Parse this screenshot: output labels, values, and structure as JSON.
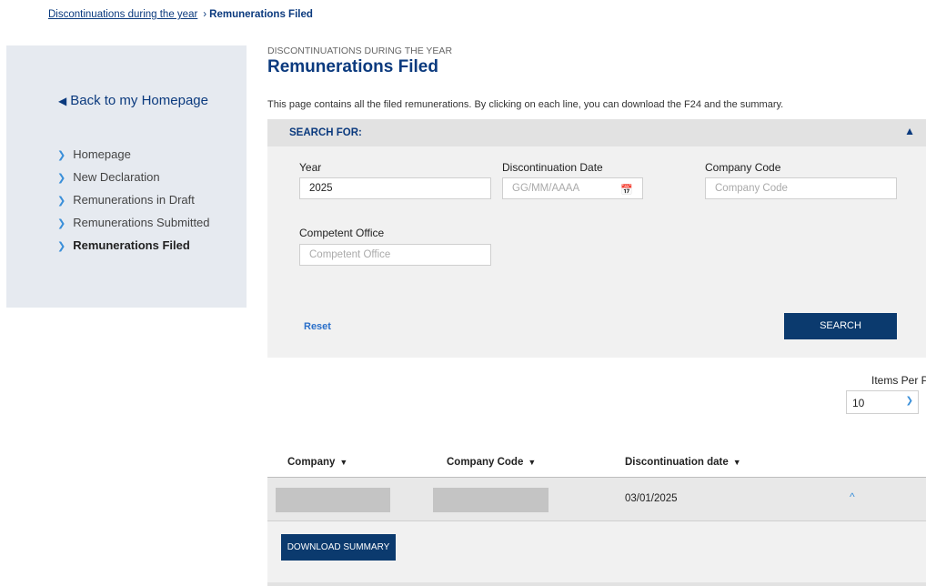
{
  "breadcrumb": {
    "parent": "Discontinuations during the year",
    "separator": "›",
    "current": "Remunerations Filed"
  },
  "sidebar": {
    "back_label": "Back to my Homepage",
    "back_icon": "◀",
    "items": [
      {
        "label": "Homepage",
        "active": false
      },
      {
        "label": "New Declaration",
        "active": false
      },
      {
        "label": "Remunerations in Draft",
        "active": false
      },
      {
        "label": "Remunerations Submitted",
        "active": false
      },
      {
        "label": "Remunerations Filed",
        "active": true
      }
    ]
  },
  "page": {
    "kicker": "DISCONTINUATIONS DURING THE YEAR",
    "title": "Remunerations Filed",
    "intro": "This page contains all the filed remunerations. By clicking on each line, you can download the F24 and the summary."
  },
  "search": {
    "header": "SEARCH FOR:",
    "year": {
      "label": "Year",
      "value": "2025"
    },
    "discontinuation_date": {
      "label": "Discontinuation Date",
      "placeholder": "GG/MM/AAAA"
    },
    "company_code": {
      "label": "Company Code",
      "placeholder": "Company Code"
    },
    "competent_office": {
      "label": "Competent Office",
      "placeholder": "Competent Office"
    },
    "reset_label": "Reset",
    "search_label": "SEARCH"
  },
  "pagination": {
    "items_per_page_label": "Items Per Page",
    "items_per_page_value": "10"
  },
  "table": {
    "columns": [
      "Company",
      "Company Code",
      "Discontinuation date"
    ],
    "sort_icon": "▼",
    "rows": [
      {
        "company": "",
        "company_code": "",
        "discontinuation_date": "03/01/2025",
        "expanded": true
      }
    ],
    "download_summary_label": "DOWNLOAD SUMMARY"
  },
  "colors": {
    "primary": "#0b3a6e",
    "link": "#0b3a7e",
    "accent": "#3a8fd9",
    "sidebar_bg": "#e6eaf0",
    "panel_bg": "#f1f1f1"
  }
}
